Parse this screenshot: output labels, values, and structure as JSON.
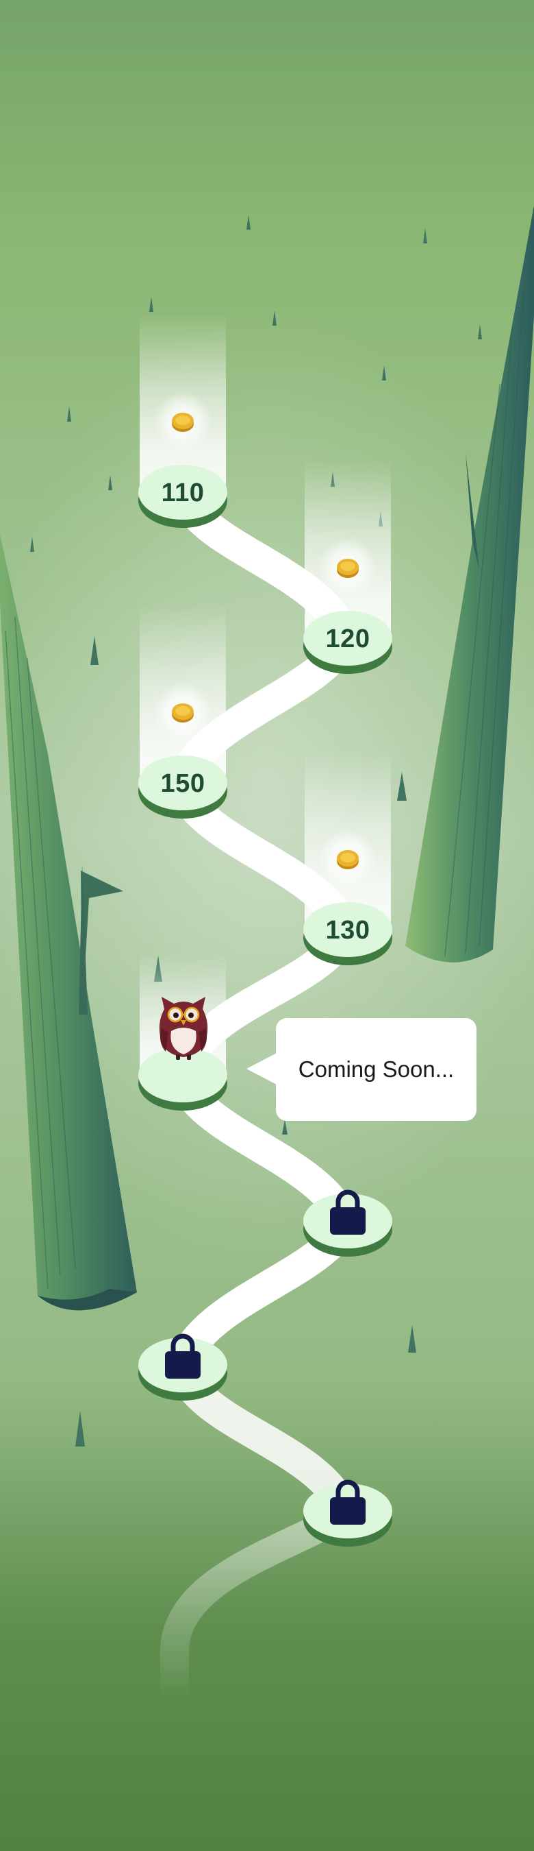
{
  "screen": "level-map",
  "colors": {
    "background_top": "#7aa86c",
    "background_mid": "#b6d2b0",
    "background_bottom": "#538245",
    "path": "#ffffff",
    "node_top": "#dcf7dc",
    "node_side": "#3f7a40",
    "node_text": "#1f4a34",
    "lock": "#141a4a",
    "coin": "#e4a926"
  },
  "levels": [
    {
      "label": "110",
      "state": "completed",
      "reward_icon": "coin-icon"
    },
    {
      "label": "120",
      "state": "completed",
      "reward_icon": "coin-icon"
    },
    {
      "label": "150",
      "state": "completed",
      "reward_icon": "coin-icon"
    },
    {
      "label": "130",
      "state": "completed",
      "reward_icon": "coin-icon"
    },
    {
      "label": "",
      "state": "current",
      "avatar_icon": "owl-icon"
    },
    {
      "label": "",
      "state": "locked",
      "icon": "lock-icon"
    },
    {
      "label": "",
      "state": "locked",
      "icon": "lock-icon"
    },
    {
      "label": "",
      "state": "locked",
      "icon": "lock-icon"
    }
  ],
  "tooltip": {
    "text": "Coming Soon..."
  },
  "decorations": {
    "trees": [
      "tree-trunk-icon",
      "tree-trunk-icon"
    ],
    "grass": "grass-sprout-icon"
  }
}
